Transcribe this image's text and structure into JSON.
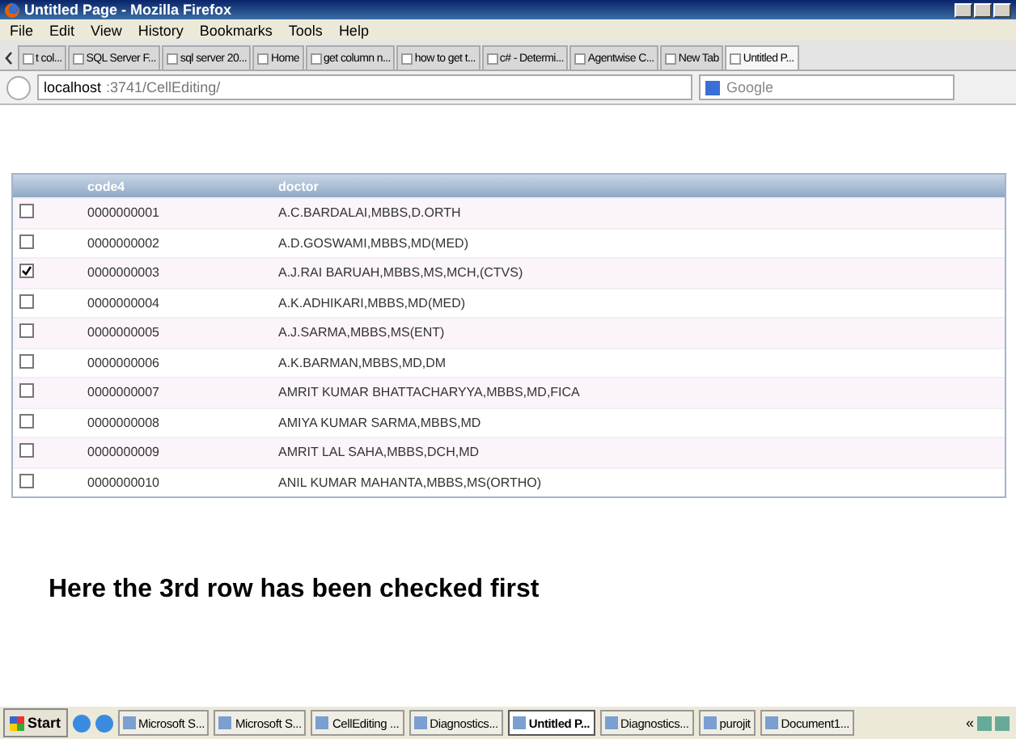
{
  "window": {
    "title": "Untitled Page - Mozilla Firefox"
  },
  "menu": [
    "File",
    "Edit",
    "View",
    "History",
    "Bookmarks",
    "Tools",
    "Help"
  ],
  "tabs": [
    {
      "label": "t col...",
      "selected": false
    },
    {
      "label": "SQL Server F...",
      "selected": false
    },
    {
      "label": "sql server 20...",
      "selected": false
    },
    {
      "label": "Home",
      "selected": false
    },
    {
      "label": "get column n...",
      "selected": false
    },
    {
      "label": "how to get t...",
      "selected": false
    },
    {
      "label": "c# - Determi...",
      "selected": false
    },
    {
      "label": "Agentwise C...",
      "selected": false
    },
    {
      "label": "New Tab",
      "selected": false
    },
    {
      "label": "Untitled P...",
      "selected": true
    }
  ],
  "address": {
    "host": "localhost",
    "path": ":3741/CellEditing/"
  },
  "search": {
    "placeholder": "Google"
  },
  "table": {
    "columns": [
      "code4",
      "doctor"
    ],
    "rows": [
      {
        "checked": false,
        "code4": "0000000001",
        "doctor": "A.C.BARDALAI,MBBS,D.ORTH"
      },
      {
        "checked": false,
        "code4": "0000000002",
        "doctor": "A.D.GOSWAMI,MBBS,MD(MED)"
      },
      {
        "checked": true,
        "code4": "0000000003",
        "doctor": "A.J.RAI BARUAH,MBBS,MS,MCH,(CTVS)"
      },
      {
        "checked": false,
        "code4": "0000000004",
        "doctor": "A.K.ADHIKARI,MBBS,MD(MED)"
      },
      {
        "checked": false,
        "code4": "0000000005",
        "doctor": "A.J.SARMA,MBBS,MS(ENT)"
      },
      {
        "checked": false,
        "code4": "0000000006",
        "doctor": "A.K.BARMAN,MBBS,MD,DM"
      },
      {
        "checked": false,
        "code4": "0000000007",
        "doctor": "AMRIT KUMAR BHATTACHARYYA,MBBS,MD,FICA"
      },
      {
        "checked": false,
        "code4": "0000000008",
        "doctor": "AMIYA KUMAR SARMA,MBBS,MD"
      },
      {
        "checked": false,
        "code4": "0000000009",
        "doctor": "AMRIT LAL SAHA,MBBS,DCH,MD"
      },
      {
        "checked": false,
        "code4": "0000000010",
        "doctor": "ANIL KUMAR MAHANTA,MBBS,MS(ORTHO)"
      }
    ]
  },
  "caption": "Here the 3rd row has been checked first",
  "taskbar": {
    "start": "Start",
    "items": [
      {
        "label": "Microsoft S...",
        "selected": false
      },
      {
        "label": "Microsoft S...",
        "selected": false
      },
      {
        "label": "CellEditing ...",
        "selected": false
      },
      {
        "label": "Diagnostics...",
        "selected": false
      },
      {
        "label": "Untitled P...",
        "selected": true
      },
      {
        "label": "Diagnostics...",
        "selected": false
      },
      {
        "label": "purojit",
        "selected": false
      },
      {
        "label": "Document1...",
        "selected": false
      }
    ],
    "tray": "«"
  }
}
